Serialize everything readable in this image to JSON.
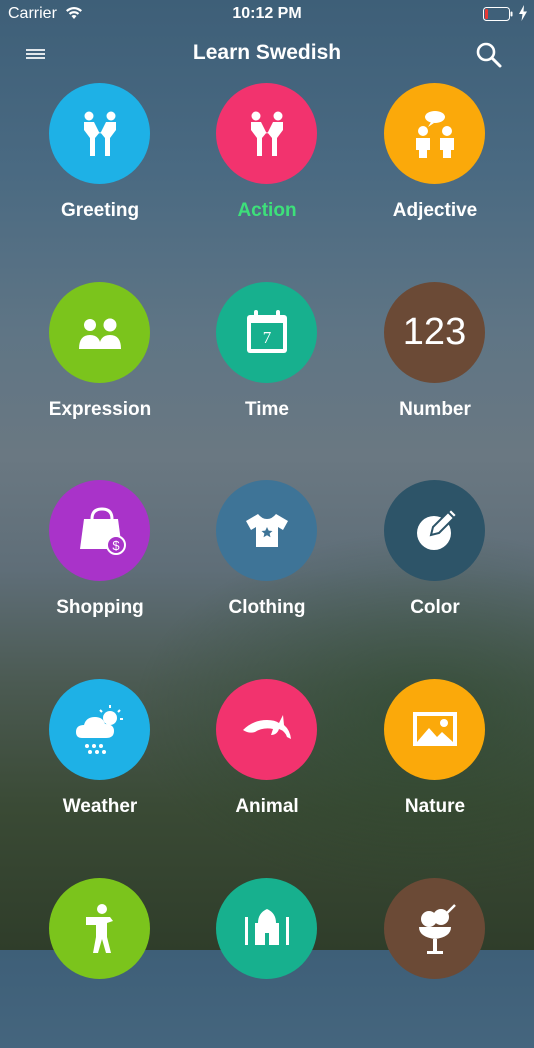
{
  "status_bar": {
    "carrier": "Carrier",
    "time": "10:12 PM",
    "icons": [
      "wifi-icon",
      "battery-icon",
      "charging-icon"
    ],
    "battery_color": "#e53935"
  },
  "nav": {
    "title": "Learn Swedish",
    "icons": [
      "menu-icon",
      "search-icon"
    ]
  },
  "categories": [
    {
      "label": "Greeting",
      "icon": "handshake-icon",
      "color": "#1eb1e6",
      "active": false
    },
    {
      "label": "Action",
      "icon": "handshake-icon",
      "color": "#f2336e",
      "active": true
    },
    {
      "label": "Adjective",
      "icon": "people-talking-icon",
      "color": "#fba90a",
      "active": false
    },
    {
      "label": "Expression",
      "icon": "people-pair-icon",
      "color": "#7bc41c",
      "active": false
    },
    {
      "label": "Time",
      "icon": "calendar-icon",
      "color": "#17b08e",
      "active": false,
      "icon_text": "7"
    },
    {
      "label": "Number",
      "icon": "numbers-icon",
      "color": "#6b4a36",
      "active": false,
      "icon_text": "123"
    },
    {
      "label": "Shopping",
      "icon": "shopping-bag-icon",
      "color": "#a933c9",
      "active": false
    },
    {
      "label": "Clothing",
      "icon": "shirt-icon",
      "color": "#3e7497",
      "active": false
    },
    {
      "label": "Color",
      "icon": "palette-pencil-icon",
      "color": "#2d5468",
      "active": false
    },
    {
      "label": "Weather",
      "icon": "cloud-snow-icon",
      "color": "#1eb1e6",
      "active": false
    },
    {
      "label": "Animal",
      "icon": "dolphin-icon",
      "color": "#f2336e",
      "active": false
    },
    {
      "label": "Nature",
      "icon": "landscape-picture-icon",
      "color": "#fba90a",
      "active": false
    },
    {
      "label": "",
      "icon": "person-bending-icon",
      "color": "#7bc41c",
      "active": false
    },
    {
      "label": "",
      "icon": "taj-mahal-icon",
      "color": "#17b08e",
      "active": false
    },
    {
      "label": "",
      "icon": "ice-cream-icon",
      "color": "#6b4a36",
      "active": false
    }
  ],
  "active_label_color": "#3de07a"
}
